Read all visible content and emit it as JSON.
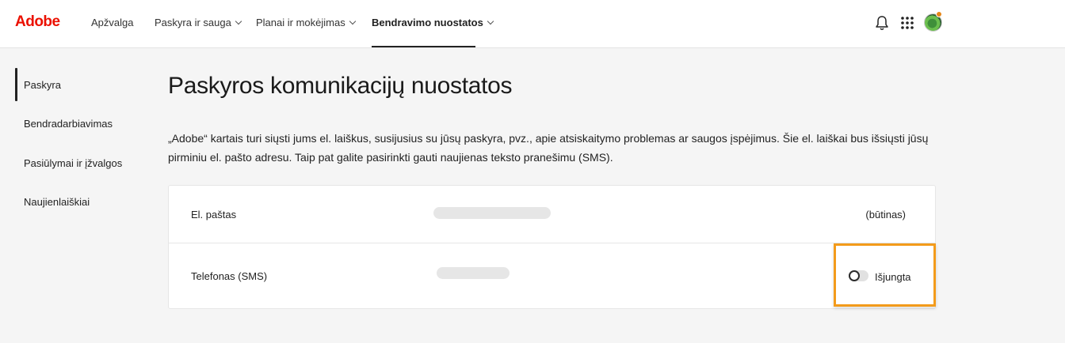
{
  "brand": {
    "logo": "Adobe",
    "logo_color": "#eb1000"
  },
  "nav": {
    "items": [
      {
        "label": "Apžvalga"
      },
      {
        "label": "Paskyra ir sauga"
      },
      {
        "label": "Planai ir mokėjimas"
      },
      {
        "label": "Bendravimo nuostatos"
      }
    ],
    "active_index": 3
  },
  "header_icons": [
    "bell-icon",
    "apps-grid-icon",
    "avatar"
  ],
  "sidebar": {
    "items": [
      {
        "label": "Paskyra"
      },
      {
        "label": "Bendradarbiavimas"
      },
      {
        "label": "Pasiūlymai ir įžvalgos"
      },
      {
        "label": "Naujienlaiškiai"
      }
    ],
    "active_index": 0
  },
  "main": {
    "title": "Paskyros komunikacijų nuostatos",
    "description": "„Adobe“ kartais turi siųsti jums el. laiškus, susijusius su jūsų paskyra, pvz., apie atsiskaitymo problemas ar saugos įspėjimus. Šie el. laiškai bus išsiųsti jūsų pirminiu el. pašto adresu. Taip pat galite pasirinkti gauti naujienas teksto pranešimu (SMS).",
    "rows": [
      {
        "label": "El. paštas",
        "status": "(būtinas)"
      },
      {
        "label": "Telefonas (SMS)",
        "toggle_label": "Išjungta",
        "toggle_on": false
      }
    ]
  },
  "highlight_color": "#f39b1b"
}
